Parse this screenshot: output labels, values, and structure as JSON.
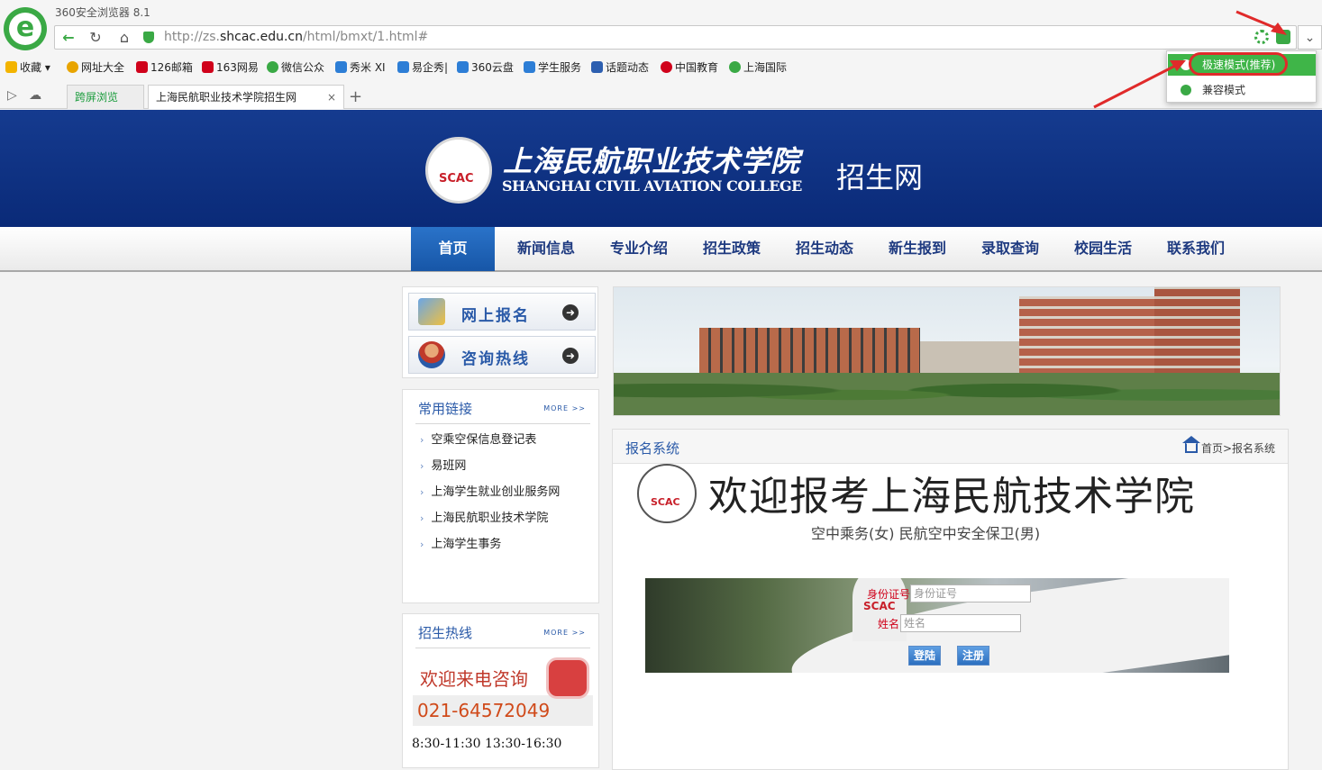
{
  "browser": {
    "app_name": "360安全浏览器 8.1",
    "url_prefix": "http://zs.",
    "url_domain": "shcac.edu.cn",
    "url_path": "/html/bmxt/1.html#",
    "bookmarks": [
      "收藏",
      "网址大全",
      "126邮箱",
      "163网易",
      "微信公众",
      "秀米 XI",
      "易企秀|",
      "360云盘",
      "学生服务",
      "话题动态",
      "中国教育",
      "上海国际"
    ],
    "tabs": {
      "cross_screen": "跨屏浏览",
      "active": "上海民航职业技术学院招生网"
    },
    "mode_menu": {
      "fast": "极速模式(推荐)",
      "compat": "兼容模式"
    }
  },
  "site": {
    "header": {
      "cn_name": "上海民航职业技术学院",
      "en_name": "SHANGHAI CIVIL AVIATION COLLEGE",
      "subtitle": "招生网",
      "seal_text": "SCAC"
    },
    "nav": [
      "首页",
      "新闻信息",
      "专业介绍",
      "招生政策",
      "招生动态",
      "新生报到",
      "录取查询",
      "校园生活",
      "联系我们"
    ],
    "quick": {
      "register": "网上报名",
      "hotline": "咨询热线"
    },
    "links_panel": {
      "title": "常用链接",
      "more": "MORE >>",
      "items": [
        "空乘空保信息登记表",
        "易班网",
        "上海学生就业创业服务网",
        "上海民航职业技术学院",
        "上海学生事务"
      ]
    },
    "hotline_panel": {
      "title": "招生热线",
      "more": "MORE >>",
      "welcome": "欢迎来电咨询",
      "phone": "021-64572049",
      "hours": "8:30-11:30 13:30-16:30"
    },
    "content": {
      "title": "报名系统",
      "breadcrumb": "首页>报名系统",
      "welcome_title": "欢迎报考上海民航技术学院",
      "welcome_sub": "空中乘务(女) 民航空中安全保卫(男)",
      "seal_text": "SCAC",
      "login": {
        "id_label": "身份证号",
        "id_placeholder": "身份证号",
        "name_label": "姓名",
        "name_placeholder": "姓名",
        "login_btn": "登陆",
        "register_btn": "注册",
        "tag": "SCAC"
      }
    }
  },
  "colors": {
    "header_blue": "#0f3285",
    "nav_active": "#1d62b5",
    "accent_green": "#3fb548",
    "annotation_red": "#e02a2a"
  }
}
